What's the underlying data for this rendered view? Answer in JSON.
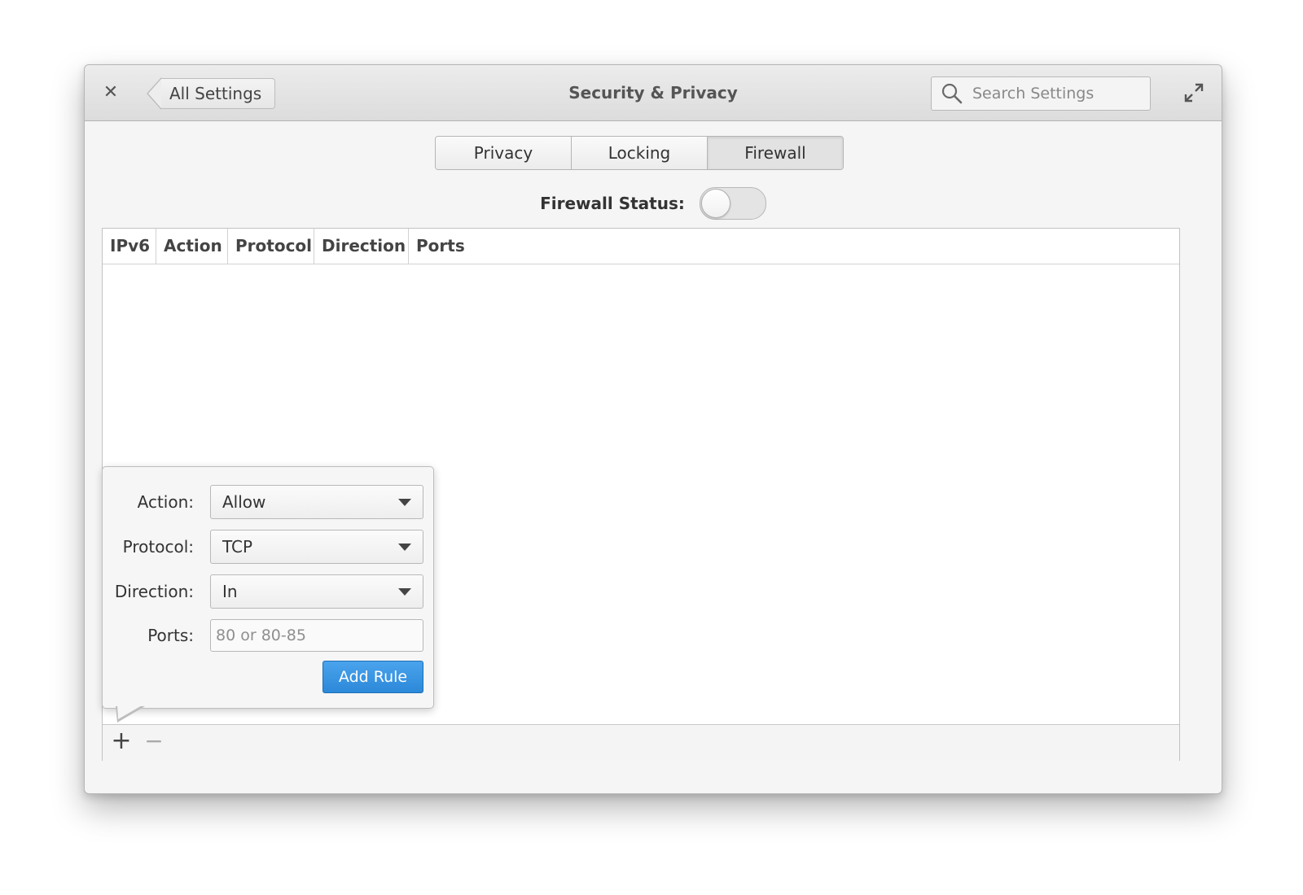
{
  "window": {
    "title": "Security & Privacy",
    "back_label": "All Settings",
    "search_placeholder": "Search Settings"
  },
  "tabs": [
    {
      "label": "Privacy",
      "active": false
    },
    {
      "label": "Locking",
      "active": false
    },
    {
      "label": "Firewall",
      "active": true
    }
  ],
  "firewall": {
    "status_label": "Firewall Status:",
    "enabled": false
  },
  "table": {
    "columns": [
      "IPv6",
      "Action",
      "Protocol",
      "Direction",
      "Ports"
    ],
    "rows": []
  },
  "popover": {
    "action_label": "Action:",
    "action_value": "Allow",
    "protocol_label": "Protocol:",
    "protocol_value": "TCP",
    "direction_label": "Direction:",
    "direction_value": "In",
    "ports_label": "Ports:",
    "ports_placeholder": "80 or 80-85",
    "ports_value": "",
    "submit_label": "Add Rule"
  },
  "footer": {
    "add_symbol": "+",
    "remove_symbol": "−"
  },
  "colors": {
    "accent": "#3592de",
    "window_bg": "#f5f5f5"
  }
}
